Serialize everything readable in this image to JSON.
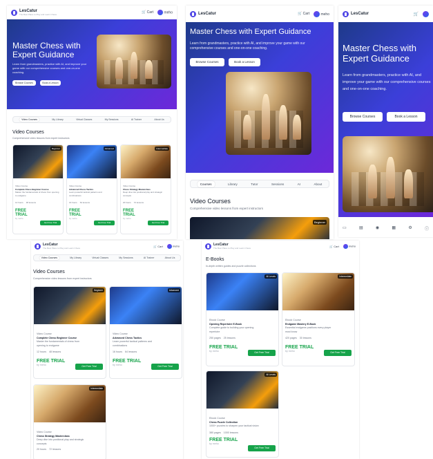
{
  "brand": {
    "name": "LesCatur",
    "tagline": "The Best Place to Play and Learn Chess"
  },
  "header": {
    "cart": "Cart",
    "user": "meho"
  },
  "hero": {
    "title": "Master Chess with Expert Guidance",
    "desc_short": "Learn from grandmasters, practice with AI, and improve your game with our comprehensive courses and one-on-one coaching.",
    "btn_browse": "Browse Courses",
    "btn_book": "Book a Lesson"
  },
  "tabs": [
    {
      "label": "Video Courses",
      "short": "Courses"
    },
    {
      "label": "My Library",
      "short": "Library"
    },
    {
      "label": "Virtual Classes",
      "short": "Tutor"
    },
    {
      "label": "My Sessions",
      "short": "Sessions"
    },
    {
      "label": "AI Trainer",
      "short": "AI"
    },
    {
      "label": "About Us",
      "short": "About"
    }
  ],
  "videos": {
    "title": "Video Courses",
    "subtitle": "Comprehensive video lessons from expert instructors",
    "items": [
      {
        "type": "Video Course",
        "badge": "Beginner",
        "title": "Complete Chess Beginner Course",
        "desc": "Master the fundamentals of chess from opening to endgame",
        "s1": "12 hours",
        "s2": "48 lessons"
      },
      {
        "type": "Video Course",
        "badge": "Advanced",
        "title": "Advanced Chess Tactics",
        "desc": "Learn powerful tactical patterns and combinations",
        "s1": "16 hours",
        "s2": "64 lessons"
      },
      {
        "type": "Video Course",
        "badge": "Intermediate",
        "title": "Chess Strategy Masterclass",
        "desc": "Deep dive into positional play and strategic concepts",
        "s1": "20 hours",
        "s2": "72 lessons"
      }
    ]
  },
  "ebooks": {
    "title": "E-Books",
    "subtitle": "In-depth written guides and puzzle collections",
    "items": [
      {
        "type": "Ebook Course",
        "badge": "All Levels",
        "title": "Opening Repertoire E-Book",
        "desc": "Complete guide to building your opening repertoire",
        "s1": "250 pages",
        "s2": "25 lessons"
      },
      {
        "type": "Ebook Course",
        "badge": "Intermediate",
        "title": "Endgame Mastery E-Book",
        "desc": "Essential endgame positions every player must know",
        "s1": "420 pages",
        "s2": "30 lessons"
      },
      {
        "type": "Ebook Course",
        "badge": "All Levels",
        "title": "Chess Puzzle Collection",
        "desc": "1000+ puzzles to sharpen your tactical vision",
        "s1": "380 pages",
        "s2": "1000 lessons"
      }
    ]
  },
  "price": {
    "free": "FREE TRIAL",
    "by": "by meho",
    "start": "Get Free Trial"
  }
}
